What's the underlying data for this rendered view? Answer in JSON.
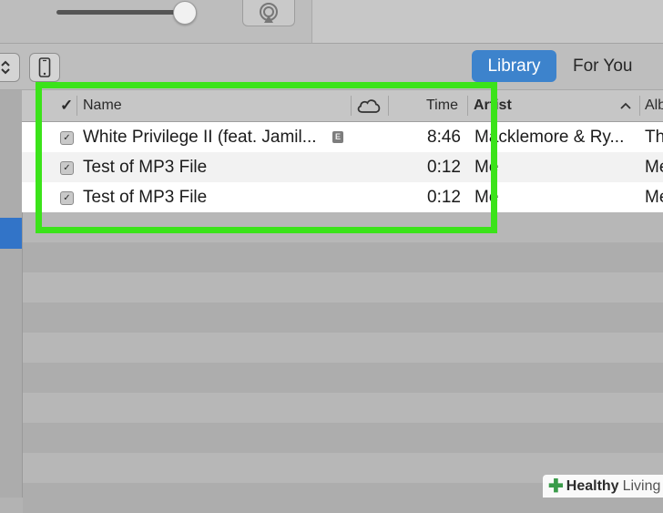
{
  "tabs": {
    "library": "Library",
    "for_you": "For You"
  },
  "columns": {
    "check": "✓",
    "name": "Name",
    "time": "Time",
    "artist": "Artist",
    "album": "Alb",
    "cloud_icon": "cloud-icon",
    "sort_icon": "chevron-up-icon"
  },
  "songs": [
    {
      "checked": true,
      "name": "White Privilege II (feat. Jamil...",
      "explicit": "E",
      "time": "8:46",
      "artist": "Macklemore & Ry...",
      "album": "Th"
    },
    {
      "checked": true,
      "name": "Test of MP3 File",
      "explicit": "",
      "time": "0:12",
      "artist": "Me",
      "album": "Me"
    },
    {
      "checked": true,
      "name": "Test of MP3 File",
      "explicit": "",
      "time": "0:12",
      "artist": "Me",
      "album": "Me"
    }
  ],
  "watermark": {
    "word1": "Healthy",
    "word2": "Living"
  },
  "colors": {
    "accent": "#3d83cc",
    "highlight": "#3be31a"
  }
}
